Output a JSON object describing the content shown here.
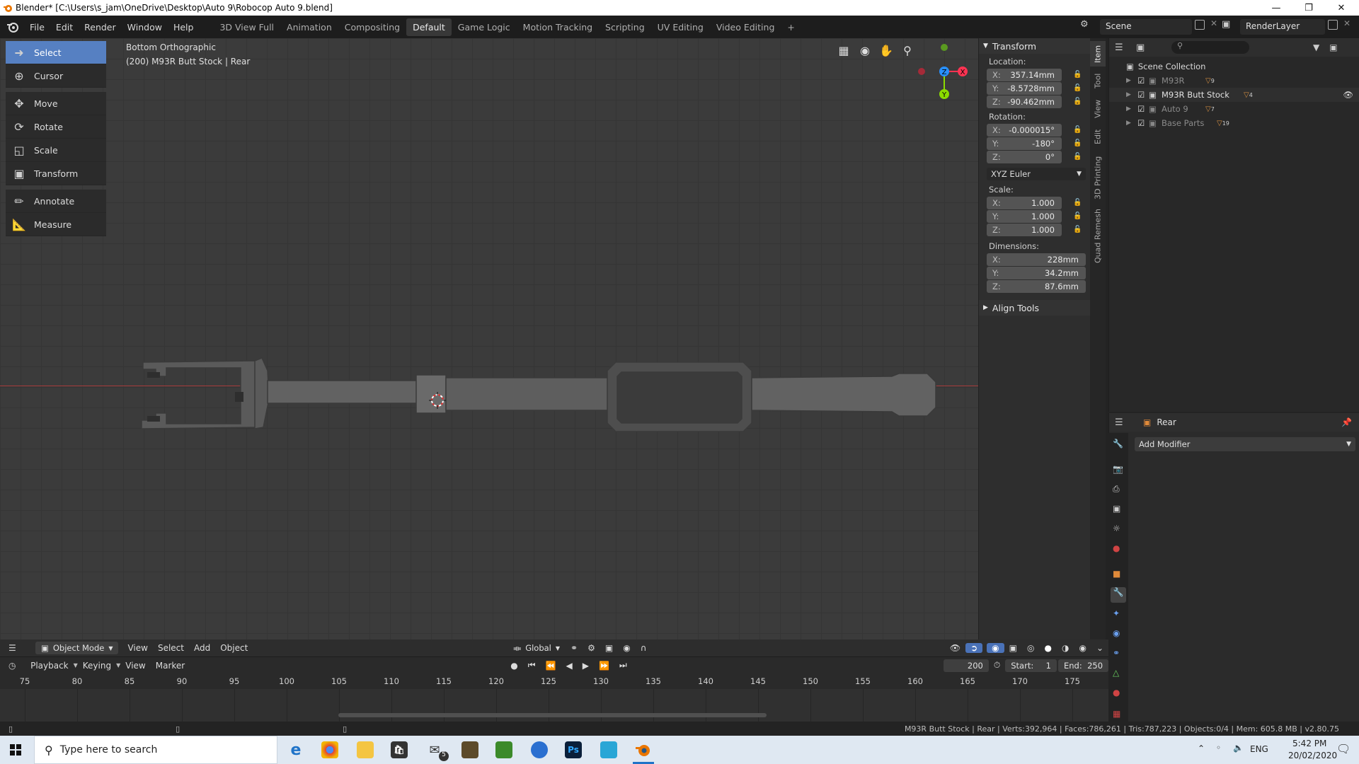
{
  "window": {
    "title": "Blender* [C:\\Users\\s_jam\\OneDrive\\Desktop\\Auto 9\\Robocop Auto 9.blend]"
  },
  "menu": {
    "items": [
      "File",
      "Edit",
      "Render",
      "Window",
      "Help"
    ],
    "workspaces": [
      "3D View Full",
      "Animation",
      "Compositing",
      "Default",
      "Game Logic",
      "Motion Tracking",
      "Scripting",
      "UV Editing",
      "Video Editing"
    ],
    "active_workspace": "Default",
    "add_tab": "+",
    "scene": "Scene",
    "render_layer": "RenderLayer"
  },
  "viewport": {
    "view_name": "Bottom Orthographic",
    "object_info": "(200) M93R Butt Stock | Rear",
    "gizmo_axes": {
      "z": "Z",
      "x": "X",
      "y": "Y"
    }
  },
  "tools": [
    "Select",
    "Cursor",
    "Move",
    "Rotate",
    "Scale",
    "Transform",
    "Annotate",
    "Measure"
  ],
  "transform_panel": {
    "title": "Transform",
    "location_label": "Location:",
    "location": {
      "x": "357.14mm",
      "y": "-8.5728mm",
      "z": "-90.462mm"
    },
    "rotation_label": "Rotation:",
    "rotation": {
      "x": "-0.000015°",
      "y": "-180°",
      "z": "0°"
    },
    "rotation_mode": "XYZ Euler",
    "scale_label": "Scale:",
    "scale": {
      "x": "1.000",
      "y": "1.000",
      "z": "1.000"
    },
    "dimensions_label": "Dimensions:",
    "dimensions": {
      "x": "228mm",
      "y": "34.2mm",
      "z": "87.6mm"
    },
    "axis_x": "X:",
    "axis_y": "Y:",
    "axis_z": "Z:",
    "align_tools": "Align Tools"
  },
  "side_tabs": [
    "Item",
    "Tool",
    "View",
    "Edit",
    "3D Printing",
    "Quad Remesh"
  ],
  "outliner": {
    "root": "Scene Collection",
    "collections": [
      {
        "name": "M93R",
        "count": "9"
      },
      {
        "name": "M93R Butt Stock",
        "count": "4"
      },
      {
        "name": "Auto 9",
        "count": "7"
      },
      {
        "name": "Base Parts",
        "count": "19"
      }
    ]
  },
  "properties": {
    "object_name": "Rear",
    "add_modifier": "Add Modifier"
  },
  "viewport_header": {
    "mode": "Object Mode",
    "menus": [
      "View",
      "Select",
      "Add",
      "Object"
    ],
    "orientation": "Global"
  },
  "timeline_header": {
    "menus": [
      "Playback",
      "Keying",
      "View",
      "Marker"
    ],
    "current_frame": "200",
    "start_label": "Start:",
    "start": "1",
    "end_label": "End:",
    "end": "250"
  },
  "timeline": {
    "ticks": [
      "75",
      "80",
      "85",
      "90",
      "95",
      "100",
      "105",
      "110",
      "115",
      "120",
      "125",
      "130",
      "135",
      "140",
      "145",
      "150",
      "155",
      "160",
      "165",
      "170",
      "175"
    ]
  },
  "status": "M93R Butt Stock | Rear | Verts:392,964 | Faces:786,261 | Tris:787,223 | Objects:0/4 | Mem: 605.8 MB | v2.80.75",
  "taskbar": {
    "search_placeholder": "Type here to search",
    "language": "ENG",
    "time": "5:42 PM",
    "date": "20/02/2020",
    "mail_badge": "5"
  },
  "colors": {
    "accent": "#5680c2",
    "x_axis": "#ff3352",
    "y_axis": "#8bdc00",
    "z_axis": "#2890ff"
  }
}
